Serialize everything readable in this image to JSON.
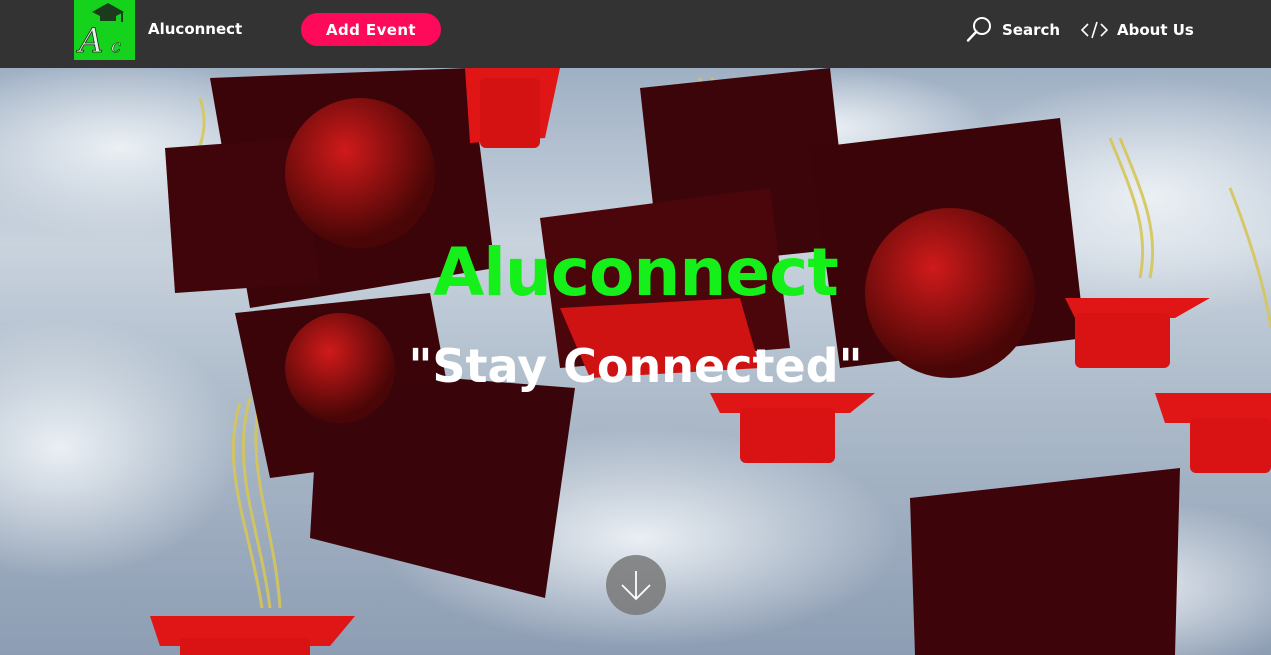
{
  "navbar": {
    "logo_letters": "Ac",
    "brand_name": "Aluconnect",
    "add_event_label": "Add Event",
    "links": [
      {
        "label": "Search",
        "icon": "search-icon"
      },
      {
        "label": "About Us",
        "icon": "code-icon"
      }
    ]
  },
  "hero": {
    "title": "Aluconnect",
    "tagline": "\"Stay Connected\"",
    "scroll_icon": "arrow-down-icon"
  },
  "colors": {
    "navbar_bg": "#333333",
    "logo_bg": "#15d31d",
    "accent_button": "#ff0a5a",
    "hero_title": "#16f01a",
    "hero_tagline": "#ffffff"
  }
}
